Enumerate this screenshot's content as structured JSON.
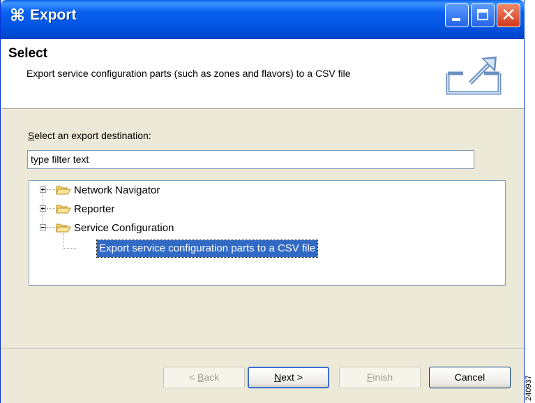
{
  "window": {
    "title": "Export",
    "titlebar_color": "#0054e3"
  },
  "banner": {
    "heading": "Select",
    "description": "Export service configuration parts (such as zones and flavors) to a CSV file"
  },
  "destination": {
    "label_first_letter": "S",
    "label_rest": "elect an export destination:",
    "filter_value": "type filter text"
  },
  "tree": {
    "items": [
      {
        "label": "Network Navigator",
        "expanded": false
      },
      {
        "label": "Reporter",
        "expanded": false
      },
      {
        "label": "Service Configuration",
        "expanded": true
      }
    ],
    "selected_child": "Export service configuration parts to a CSV file",
    "selection_color": "#316ac5"
  },
  "buttons": {
    "back": {
      "prefix": "< ",
      "mnemonic": "B",
      "rest": "ack"
    },
    "next": {
      "mnemonic": "N",
      "rest": "ext >"
    },
    "finish": {
      "mnemonic": "F",
      "rest": "inish"
    },
    "cancel": "Cancel"
  },
  "figure_id": "240937"
}
